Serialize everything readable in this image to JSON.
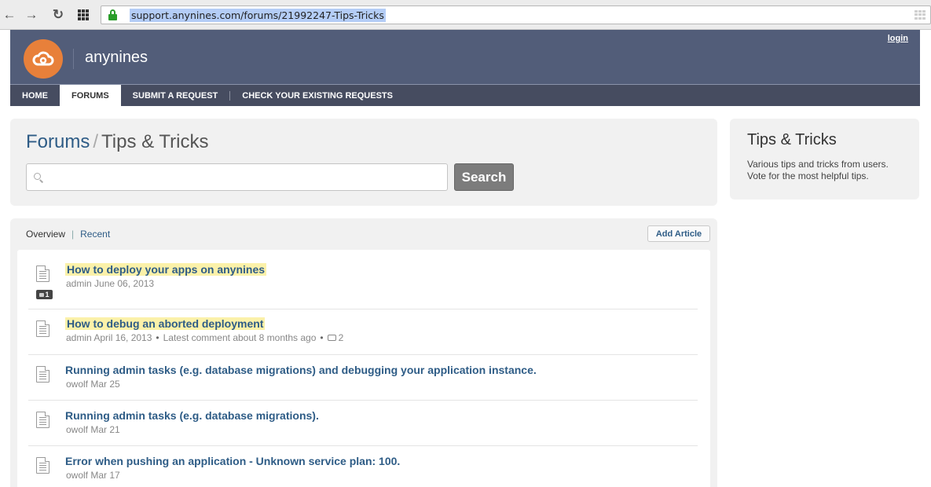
{
  "browser": {
    "url": "support.anynines.com/forums/21992247-Tips-Tricks"
  },
  "header": {
    "brand": "anynines",
    "login_label": "login",
    "nav": [
      {
        "label": "HOME"
      },
      {
        "label": "FORUMS"
      },
      {
        "label": "SUBMIT A REQUEST"
      },
      {
        "label": "CHECK YOUR EXISTING REQUESTS"
      }
    ],
    "brand_color": "#525d79",
    "logo_color": "#e8803a"
  },
  "main": {
    "breadcrumb": {
      "root": "Forums",
      "separator": "/",
      "current": "Tips & Tricks"
    },
    "search": {
      "placeholder": "",
      "button_label": "Search"
    }
  },
  "sidebar": {
    "title": "Tips & Tricks",
    "description": "Various tips and tricks from users. Vote for the most helpful tips."
  },
  "articles_panel": {
    "tabs": {
      "overview": "Overview",
      "separator": "|",
      "recent": "Recent"
    },
    "add_button": "Add Article",
    "articles": [
      {
        "title": "How to deploy your apps on anynines",
        "meta": "admin June 06, 2013",
        "votes": "1",
        "highlighted": true
      },
      {
        "title": "How to debug an aborted deployment",
        "meta": "admin April 16, 2013",
        "latest": "Latest comment about 8 months ago",
        "comments": "2",
        "highlighted": true
      },
      {
        "title": "Running admin tasks (e.g. database migrations) and debugging your application instance.",
        "meta": "owolf Mar 25"
      },
      {
        "title": "Running admin tasks (e.g. database migrations).",
        "meta": "owolf Mar 21"
      },
      {
        "title": "Error when pushing an application - Unknown service plan: 100.",
        "meta": "owolf Mar 17"
      }
    ]
  }
}
